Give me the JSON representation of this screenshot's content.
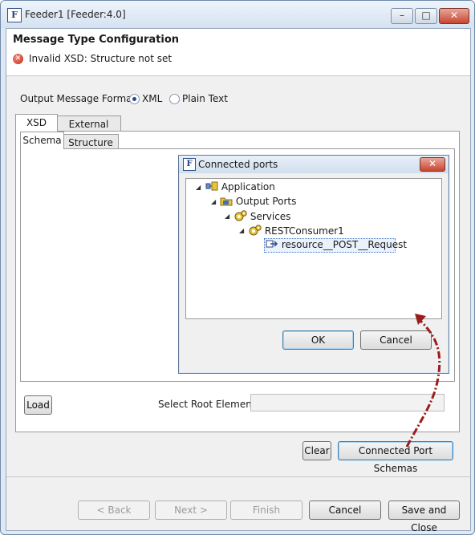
{
  "window": {
    "title": "Feeder1 [Feeder:4.0]",
    "min": "–",
    "max": "□",
    "close": "✕",
    "app_icon": "F"
  },
  "header": {
    "title": "Message Type Configuration",
    "error": "Invalid XSD: Structure not set",
    "error_glyph": "✕"
  },
  "format": {
    "label": "Output Message Format:",
    "options": [
      "XML",
      "Plain Text"
    ],
    "selected": "XML"
  },
  "outer_tabs": [
    "XSD",
    "External XSDs"
  ],
  "inner_tabs": [
    "Schema",
    "Structure"
  ],
  "load_button": "Load",
  "root_element_label": "Select Root Element",
  "clear_button": "Clear",
  "connected_schemas_button": "Connected Port Schemas",
  "dialog": {
    "title": "Connected ports",
    "icon": "F",
    "close": "✕",
    "tree": [
      "Application",
      "Output Ports",
      "Services",
      "RESTConsumer1",
      "resource__POST__Request"
    ],
    "ok": "OK",
    "cancel": "Cancel"
  },
  "footer": {
    "back": "< Back",
    "next": "Next >",
    "finish": "Finish",
    "cancel": "Cancel",
    "save_close": "Save and Close"
  },
  "colors": {
    "accent": "#3c7fb1",
    "arrow": "#9b1c1c",
    "error": "#c32a15"
  }
}
